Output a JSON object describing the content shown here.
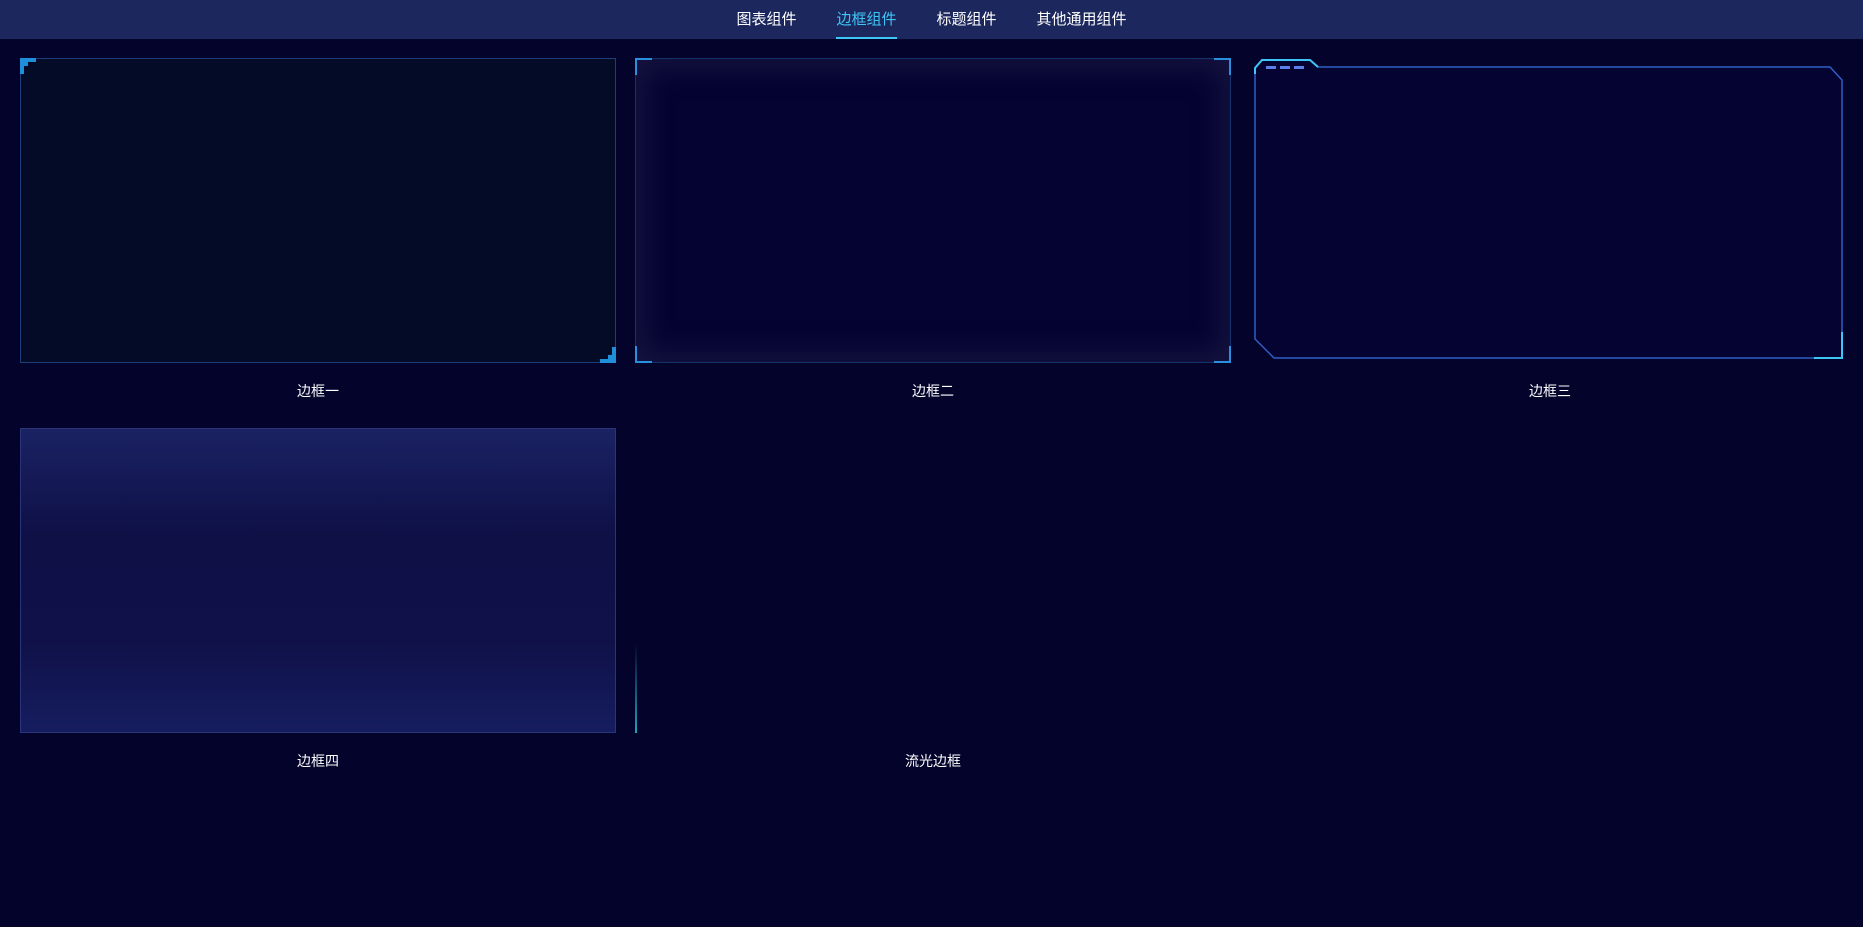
{
  "tabs": [
    {
      "label": "图表组件",
      "active": false
    },
    {
      "label": "边框组件",
      "active": true
    },
    {
      "label": "标题组件",
      "active": false
    },
    {
      "label": "其他通用组件",
      "active": false
    }
  ],
  "cards": [
    {
      "caption": "边框一"
    },
    {
      "caption": "边框二"
    },
    {
      "caption": "边框三"
    },
    {
      "caption": "边框四"
    },
    {
      "caption": "流光边框"
    }
  ],
  "colors": {
    "background": "#04032c",
    "topbar": "#1b275d",
    "accent": "#3ec6f6",
    "border_blue": "#1e8fd8"
  }
}
